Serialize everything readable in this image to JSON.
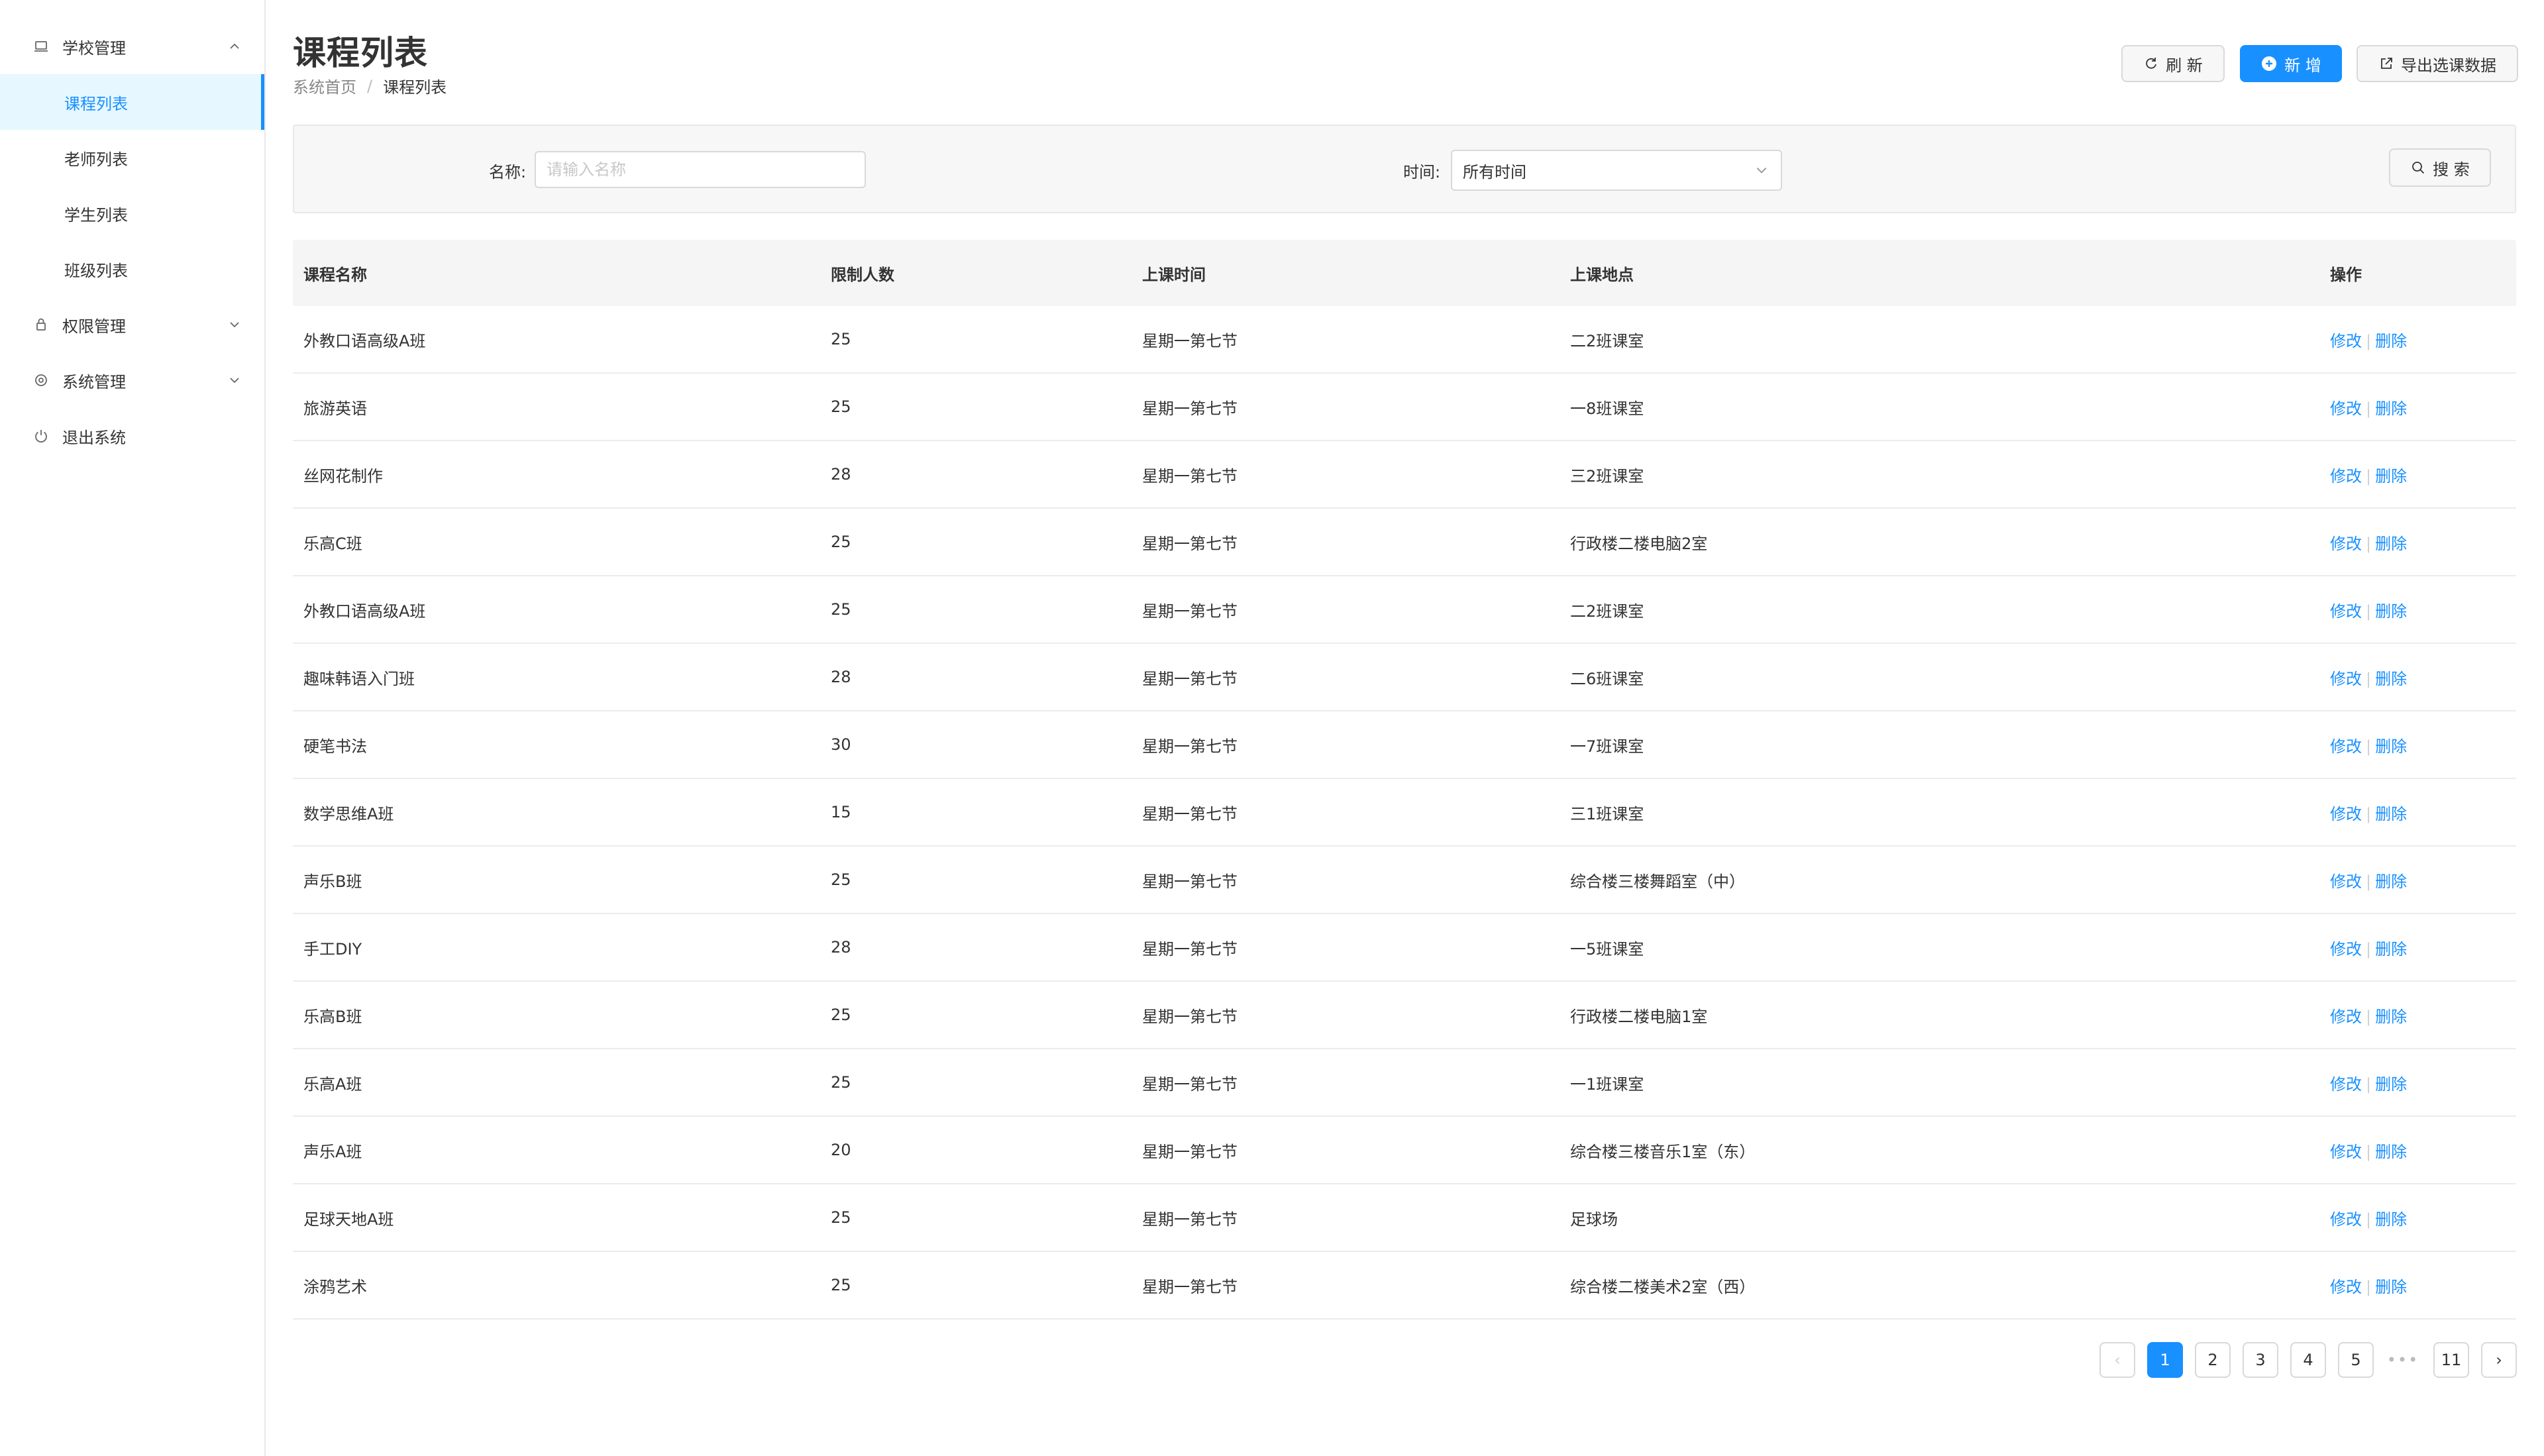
{
  "sidebar": {
    "groups": [
      {
        "label": "学校管理",
        "icon": "laptop-icon",
        "expanded": true
      },
      {
        "label": "权限管理",
        "icon": "lock-icon",
        "expanded": false
      },
      {
        "label": "系统管理",
        "icon": "gear-icon",
        "expanded": false
      },
      {
        "label": "退出系统",
        "icon": "power-icon"
      }
    ],
    "school_items": [
      {
        "label": "课程列表",
        "active": true
      },
      {
        "label": "老师列表",
        "active": false
      },
      {
        "label": "学生列表",
        "active": false
      },
      {
        "label": "班级列表",
        "active": false
      }
    ]
  },
  "header": {
    "title": "课程列表",
    "breadcrumb_home": "系统首页",
    "breadcrumb_sep": "/",
    "breadcrumb_current": "课程列表",
    "refresh_label": "刷 新",
    "add_label": "新 增",
    "export_label": "导出选课数据"
  },
  "filter": {
    "name_label": "名称:",
    "name_placeholder": "请输入名称",
    "name_value": "",
    "time_label": "时间:",
    "time_value": "所有时间",
    "search_label": "搜 索"
  },
  "table": {
    "columns": [
      "课程名称",
      "限制人数",
      "上课时间",
      "上课地点",
      "操作"
    ],
    "edit_label": "修改",
    "delete_label": "删除",
    "op_sep": "|",
    "rows": [
      {
        "name": "外教口语高级A班",
        "limit": "25",
        "time": "星期一第七节",
        "place": "二2班课室"
      },
      {
        "name": "旅游英语",
        "limit": "25",
        "time": "星期一第七节",
        "place": "一8班课室"
      },
      {
        "name": "丝网花制作",
        "limit": "28",
        "time": "星期一第七节",
        "place": "三2班课室"
      },
      {
        "name": "乐高C班",
        "limit": "25",
        "time": "星期一第七节",
        "place": "行政楼二楼电脑2室"
      },
      {
        "name": "外教口语高级A班",
        "limit": "25",
        "time": "星期一第七节",
        "place": "二2班课室"
      },
      {
        "name": "趣味韩语入门班",
        "limit": "28",
        "time": "星期一第七节",
        "place": "二6班课室"
      },
      {
        "name": "硬笔书法",
        "limit": "30",
        "time": "星期一第七节",
        "place": "一7班课室"
      },
      {
        "name": "数学思维A班",
        "limit": "15",
        "time": "星期一第七节",
        "place": "三1班课室"
      },
      {
        "name": "声乐B班",
        "limit": "25",
        "time": "星期一第七节",
        "place": "综合楼三楼舞蹈室（中）"
      },
      {
        "name": "手工DIY",
        "limit": "28",
        "time": "星期一第七节",
        "place": "一5班课室"
      },
      {
        "name": "乐高B班",
        "limit": "25",
        "time": "星期一第七节",
        "place": "行政楼二楼电脑1室"
      },
      {
        "name": "乐高A班",
        "limit": "25",
        "time": "星期一第七节",
        "place": "一1班课室"
      },
      {
        "name": "声乐A班",
        "limit": "20",
        "time": "星期一第七节",
        "place": "综合楼三楼音乐1室（东）"
      },
      {
        "name": "足球天地A班",
        "limit": "25",
        "time": "星期一第七节",
        "place": "足球场"
      },
      {
        "name": "涂鸦艺术",
        "limit": "25",
        "time": "星期一第七节",
        "place": "综合楼二楼美术2室（西）"
      }
    ]
  },
  "pagination": {
    "prev": "‹",
    "pages": [
      "1",
      "2",
      "3",
      "4",
      "5"
    ],
    "current": "1",
    "ellipsis": "•••",
    "last": "11",
    "next": "›"
  },
  "colors": {
    "accent": "#1890ff",
    "active_bg": "#e6f7ff"
  }
}
